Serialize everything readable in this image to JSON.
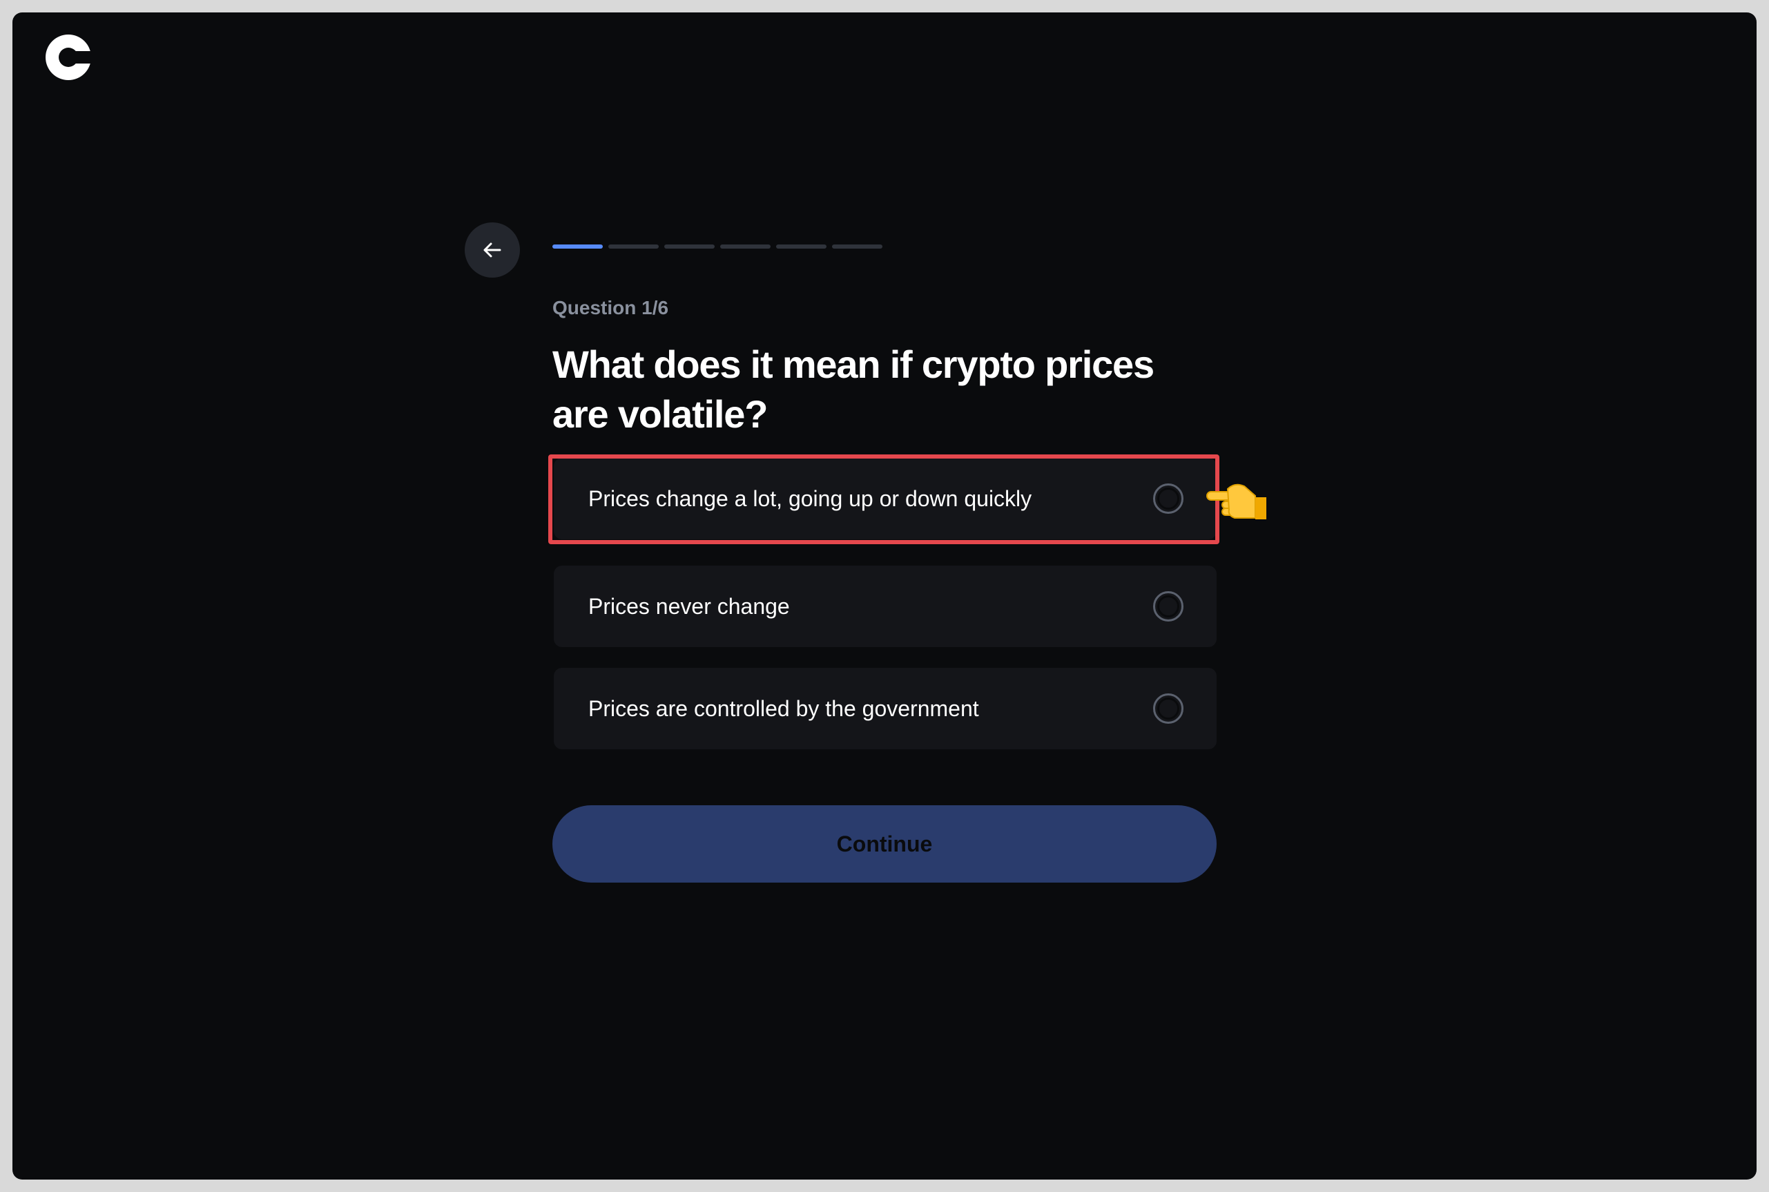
{
  "header": {
    "logo_icon": "coinbase-logo-icon"
  },
  "quiz": {
    "back_icon": "arrow-left-icon",
    "progress": {
      "current": 1,
      "total": 6
    },
    "question_number": "Question 1/6",
    "question": "What does it mean if crypto prices are volatile?",
    "options": [
      {
        "label": "Prices change a lot, going up or down quickly",
        "selected": false
      },
      {
        "label": "Prices never change",
        "selected": false
      },
      {
        "label": "Prices are controlled by the government",
        "selected": false
      }
    ],
    "continue_label": "Continue"
  },
  "annotation": {
    "highlight_color": "#e5484d",
    "pointer_icon": "pointing-hand-icon"
  },
  "colors": {
    "background": "#0a0b0d",
    "accent": "#578bfa",
    "button": "#2a3c6d"
  }
}
